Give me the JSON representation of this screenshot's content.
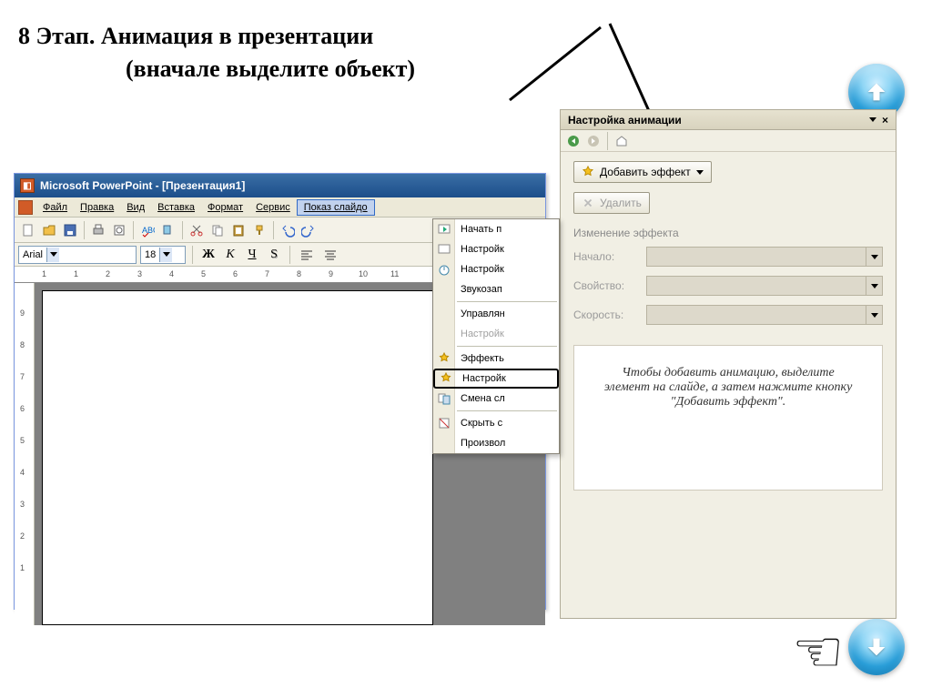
{
  "heading": {
    "line1": "8 Этап. Анимация в презентации",
    "line2": "(вначале выделите объект)"
  },
  "pp": {
    "title": "Microsoft PowerPoint - [Презентация1]",
    "menu": [
      "Файл",
      "Правка",
      "Вид",
      "Вставка",
      "Формат",
      "Сервис",
      "Показ слайдо"
    ],
    "font_name": "Arial",
    "font_size": "18",
    "fmt_bold": "Ж",
    "fmt_italic": "К",
    "fmt_under": "Ч",
    "fmt_shadow": "S"
  },
  "dropdown": {
    "items": [
      {
        "label": "Начать п",
        "icon": "play"
      },
      {
        "label": "Настройк",
        "icon": "gear"
      },
      {
        "label": "Настройк",
        "icon": "timer"
      },
      {
        "label": "Звукозап",
        "icon": "mic"
      },
      {
        "label": "Управлян",
        "icon": ""
      },
      {
        "label": "Настройк",
        "icon": "",
        "disabled": true
      },
      {
        "label": "Эффекть",
        "icon": "star"
      },
      {
        "label": "Настройк",
        "icon": "anim",
        "boxed": true
      },
      {
        "label": "Смена сл",
        "icon": "swap"
      },
      {
        "label": "Скрыть с",
        "icon": "hide"
      },
      {
        "label": "Произвол",
        "icon": ""
      }
    ]
  },
  "anim": {
    "title": "Настройка анимации",
    "add_effect": "Добавить эффект",
    "remove": "Удалить",
    "change_label": "Изменение эффекта",
    "rows": {
      "start": "Начало:",
      "prop": "Свойство:",
      "speed": "Скорость:"
    },
    "help": "Чтобы добавить анимацию, выделите элемент на слайде, а затем нажмите кнопку \"Добавить эффект\"."
  },
  "hand": "☞"
}
